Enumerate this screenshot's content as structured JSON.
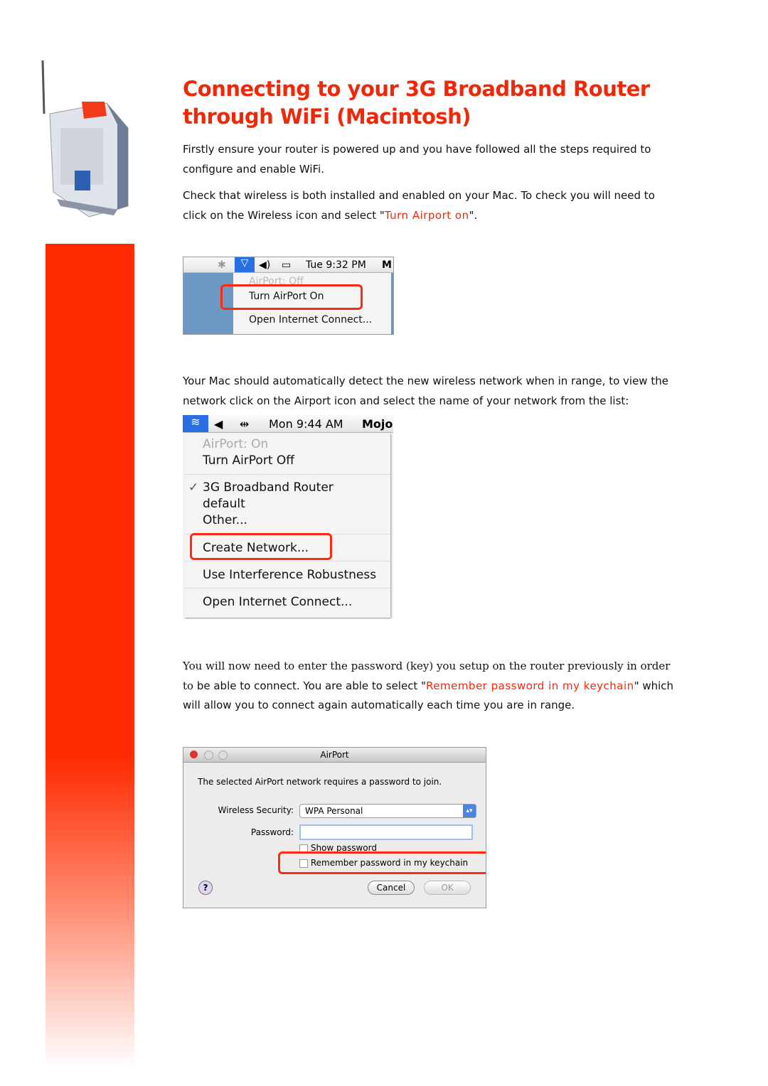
{
  "title": {
    "line1": "Connecting to your 3G Broadband Router",
    "line2": "through WiFi (Macintosh)"
  },
  "para1": "Firstly ensure your router is powered up and you have followed all the steps required to configure and enable WiFi.",
  "para2": {
    "before": "Check that wireless is both installed and enabled on your Mac. To check you will need to click on the Wireless icon and select \"",
    "highlight": "Turn Airport on",
    "after": "\"."
  },
  "shot1": {
    "clock": "Tue 9:32 PM",
    "menu_extra": "M",
    "status": "AirPort: Off",
    "item1": "Turn AirPort On",
    "item2": "Open Internet Connect..."
  },
  "para3": "Your Mac should automatically detect the new wireless network when in range, to view the network click on the Airport icon and select the name of your network from the list:",
  "shot2": {
    "clock": "Mon 9:44 AM",
    "user": "Mojo",
    "status": "AirPort: On",
    "toggle": "Turn AirPort Off",
    "networks": [
      "3G Broadband Router",
      "default",
      "Other..."
    ],
    "create": "Create Network...",
    "interference": "Use Interference Robustness",
    "connect": "Open Internet Connect..."
  },
  "para4": {
    "serif_part": "You will now need to enter the password (key) you setup on the router previously in order to",
    "before": "be able to connect. You are able to select \"",
    "highlight": "Remember password in my keychain",
    "after": "\" which will allow you to connect again automatically each time you are in range."
  },
  "dialog": {
    "title": "AirPort",
    "message": "The selected AirPort network requires a password to join.",
    "security_label": "Wireless Security:",
    "security_value": "WPA Personal",
    "password_label": "Password:",
    "password_value": "",
    "show_password": "Show password",
    "remember": "Remember password in my keychain",
    "cancel": "Cancel",
    "ok": "OK",
    "help": "?"
  },
  "colors": {
    "accent": "#f0280a",
    "sidebar": "#ff2a00"
  }
}
